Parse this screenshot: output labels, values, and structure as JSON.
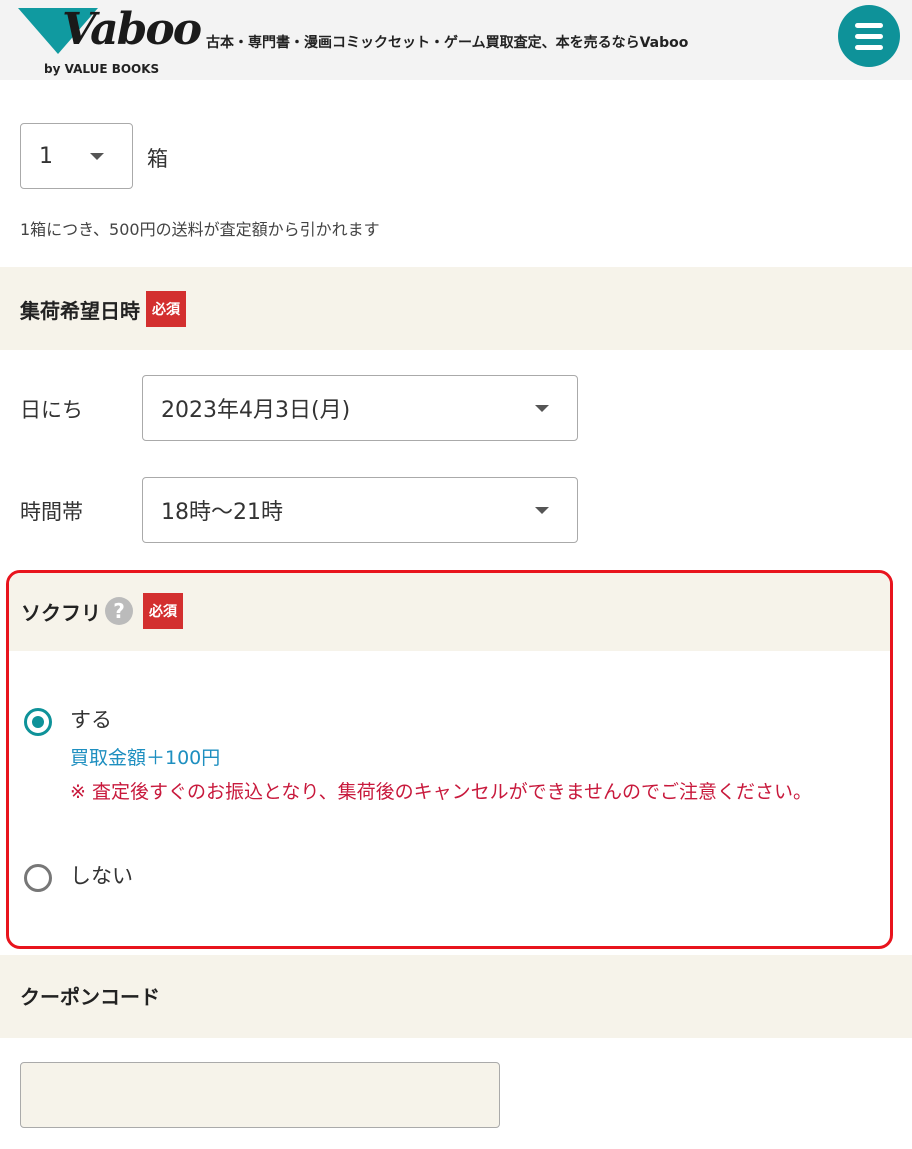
{
  "header": {
    "logo_text": "Vaboo",
    "logo_byline": "by VALUE BOOKS",
    "tagline": "古本・専門書・漫画コミックセット・ゲーム買取査定、本を売るならVaboo",
    "menu_icon": "hamburger-icon",
    "brand_color": "#0e9299"
  },
  "boxes": {
    "quantity": "1",
    "unit": "箱",
    "note": "1箱につき、500円の送料が査定額から引かれます"
  },
  "pickup": {
    "title": "集荷希望日時",
    "required": "必須",
    "date_label": "日にち",
    "date_value": "2023年4月3日(月)",
    "time_label": "時間帯",
    "time_value": "18時〜21時"
  },
  "sokufuri": {
    "title": "ソクフリ",
    "help_icon": "question-icon",
    "required": "必須",
    "options": [
      {
        "label": "する",
        "selected": true,
        "bonus": "買取金額＋100円",
        "warning": "※ 査定後すぐのお振込となり、集荷後のキャンセルができませんのでご注意ください。"
      },
      {
        "label": "しない",
        "selected": false
      }
    ],
    "highlight_color": "#e8141d"
  },
  "coupon": {
    "title": "クーポンコード",
    "value": ""
  }
}
